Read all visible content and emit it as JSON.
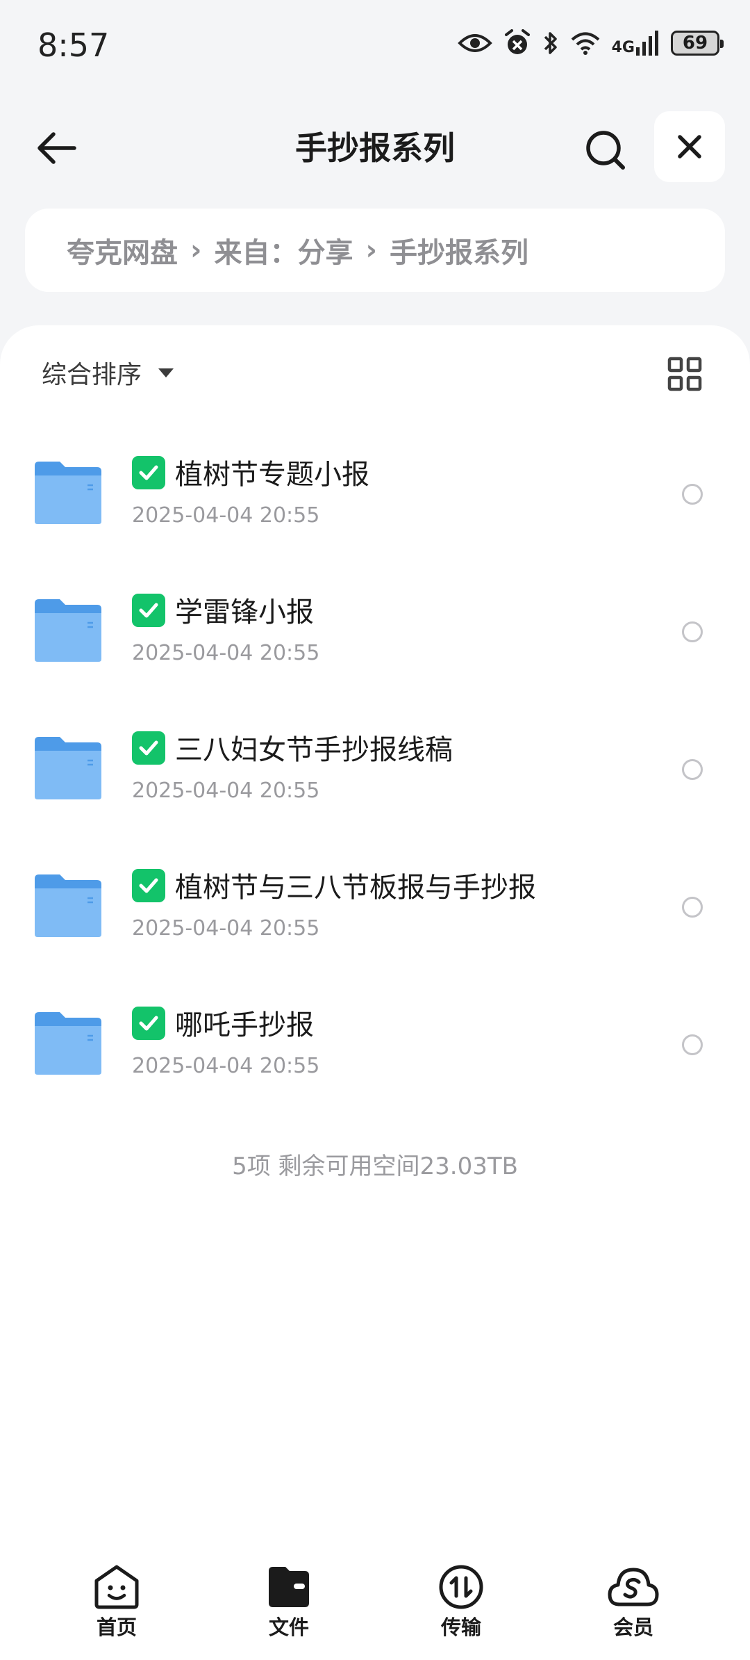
{
  "status_bar": {
    "time": "8:57",
    "network": "4G",
    "battery": "69",
    "icons": [
      "eye-icon",
      "alarm-icon",
      "bluetooth-icon",
      "wifi-icon",
      "signal-icon",
      "battery-icon"
    ]
  },
  "header": {
    "title": "手抄报系列",
    "back_icon": "arrow-left-icon",
    "search_icon": "search-icon",
    "close_icon": "close-icon"
  },
  "breadcrumb": {
    "items": [
      "夸克网盘",
      "来自：分享",
      "手抄报系列"
    ]
  },
  "toolbar": {
    "sort_label": "综合排序",
    "view_icon": "grid-view-icon"
  },
  "files": [
    {
      "name": "植树节专题小报",
      "date": "2025-04-04 20:55"
    },
    {
      "name": "学雷锋小报",
      "date": "2025-04-04 20:55"
    },
    {
      "name": "三八妇女节手抄报线稿",
      "date": "2025-04-04 20:55"
    },
    {
      "name": "植树节与三八节板报与手抄报",
      "date": "2025-04-04 20:55"
    },
    {
      "name": "哪吒手抄报",
      "date": "2025-04-04 20:55"
    }
  ],
  "summary": "5项 剩余可用空间23.03TB",
  "tabs": [
    {
      "label": "首页",
      "icon": "smile-home-icon"
    },
    {
      "label": "文件",
      "icon": "folder-wallet-icon",
      "active": true
    },
    {
      "label": "传输",
      "icon": "transfer-icon"
    },
    {
      "label": "会员",
      "icon": "cloud-member-icon"
    }
  ],
  "colors": {
    "accent_check": "#13c36a",
    "folder_blue": "#6fb1f2",
    "background": "#f4f5f7"
  }
}
